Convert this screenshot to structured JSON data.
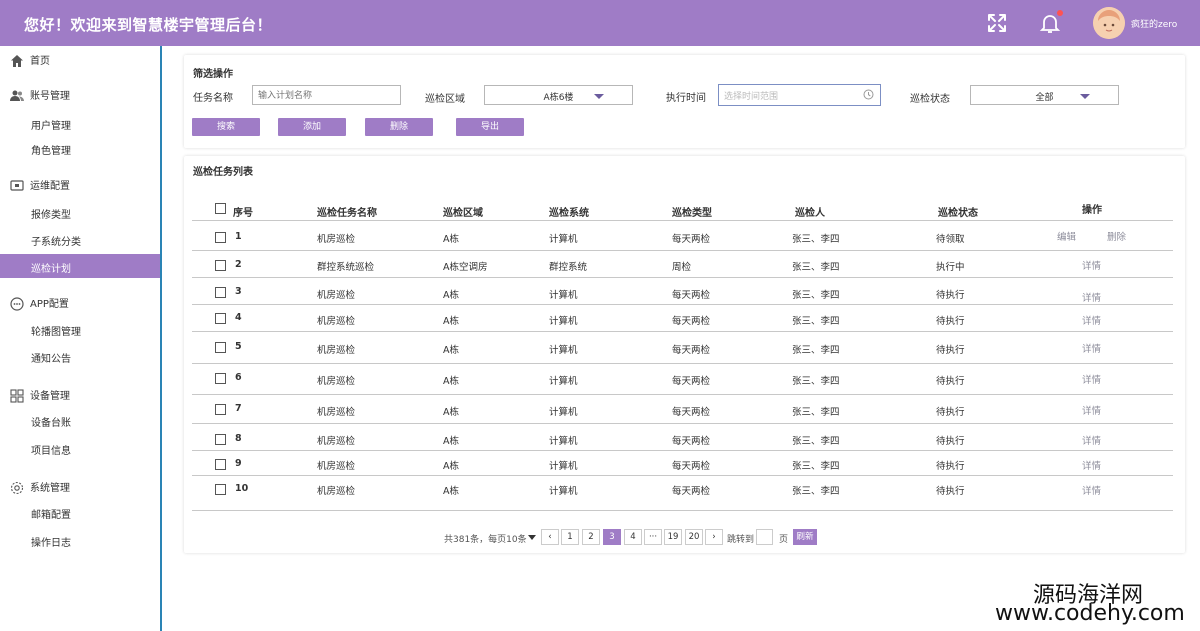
{
  "header": {
    "title": "您好！欢迎来到智慧楼宇管理后台！",
    "username": "疯狂的zero"
  },
  "sidebar": {
    "home": "首页",
    "account_group": "账号管理",
    "user_mgmt": "用户管理",
    "role_mgmt": "角色管理",
    "ops_group": "运维配置",
    "repair_type": "报修类型",
    "subsystem": "子系统分类",
    "patrol_plan": "巡检计划",
    "app_group": "APP配置",
    "carousel": "轮播图管理",
    "notice": "通知公告",
    "device_group": "设备管理",
    "device_ledger": "设备台账",
    "project_info": "项目信息",
    "system_group": "系统管理",
    "mail_config": "邮箱配置",
    "op_log": "操作日志"
  },
  "filter": {
    "section_title": "筛选操作",
    "task_name_label": "任务名称",
    "task_name_placeholder": "输入计划名称",
    "area_label": "巡检区域",
    "area_value": "A栋6楼",
    "time_label": "执行时间",
    "time_placeholder": "选择时间范围",
    "status_label": "巡检状态",
    "status_value": "全部",
    "btn_search": "搜索",
    "btn_add": "添加",
    "btn_delete": "删除",
    "btn_export": "导出"
  },
  "table": {
    "section_title": "巡检任务列表",
    "headers": [
      "序号",
      "巡检任务名称",
      "巡检区域",
      "巡检系统",
      "巡检类型",
      "巡检人",
      "巡检状态",
      "操作"
    ],
    "rows": [
      {
        "no": "1",
        "name": "机房巡检",
        "area": "A栋",
        "system": "计算机",
        "type": "每天两检",
        "person": "张三、李四",
        "status": "待领取"
      },
      {
        "no": "2",
        "name": "群控系统巡检",
        "area": "A栋空调房",
        "system": "群控系统",
        "type": "周检",
        "person": "张三、李四",
        "status": "执行中"
      },
      {
        "no": "3",
        "name": "机房巡检",
        "area": "A栋",
        "system": "计算机",
        "type": "每天两检",
        "person": "张三、李四",
        "status": "待执行"
      },
      {
        "no": "4",
        "name": "机房巡检",
        "area": "A栋",
        "system": "计算机",
        "type": "每天两检",
        "person": "张三、李四",
        "status": "待执行"
      },
      {
        "no": "5",
        "name": "机房巡检",
        "area": "A栋",
        "system": "计算机",
        "type": "每天两检",
        "person": "张三、李四",
        "status": "待执行"
      },
      {
        "no": "6",
        "name": "机房巡检",
        "area": "A栋",
        "system": "计算机",
        "type": "每天两检",
        "person": "张三、李四",
        "status": "待执行"
      },
      {
        "no": "7",
        "name": "机房巡检",
        "area": "A栋",
        "system": "计算机",
        "type": "每天两检",
        "person": "张三、李四",
        "status": "待执行"
      },
      {
        "no": "8",
        "name": "机房巡检",
        "area": "A栋",
        "system": "计算机",
        "type": "每天两检",
        "person": "张三、李四",
        "status": "待执行"
      },
      {
        "no": "9",
        "name": "机房巡检",
        "area": "A栋",
        "system": "计算机",
        "type": "每天两检",
        "person": "张三、李四",
        "status": "待执行"
      },
      {
        "no": "10",
        "name": "机房巡检",
        "area": "A栋",
        "system": "计算机",
        "type": "每天两检",
        "person": "张三、李四",
        "status": "待执行"
      }
    ],
    "edit_label": "编辑",
    "delete_label": "删除",
    "detail_label": "详情"
  },
  "pagination": {
    "summary": "共381条，每页10条",
    "pages": [
      "1",
      "2",
      "3",
      "4",
      "···",
      "19",
      "20"
    ],
    "current": "3",
    "prev": "‹",
    "next": "›",
    "jump_label": "跳转到",
    "page_unit": "页",
    "refresh": "刷新"
  },
  "watermark": {
    "line1": "源码海洋网",
    "line2": "www.codehy.com"
  },
  "colors": {
    "accent": "#9f7cc6",
    "sidebar_border": "#2a84b5"
  }
}
